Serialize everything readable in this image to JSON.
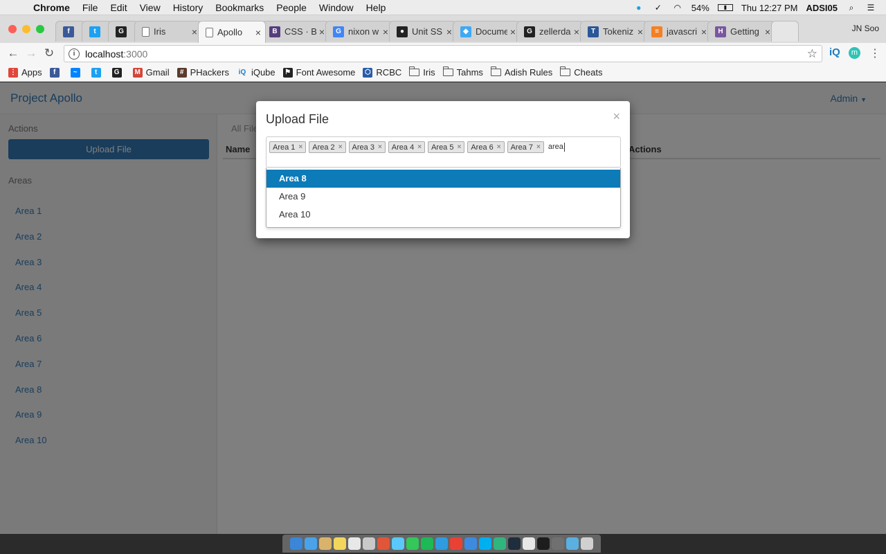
{
  "menubar": {
    "app": "Chrome",
    "items": [
      "File",
      "Edit",
      "View",
      "History",
      "Bookmarks",
      "People",
      "Window",
      "Help"
    ],
    "battery": "54%",
    "clock": "Thu 12:27 PM",
    "user": "ADSI05"
  },
  "tabs": [
    {
      "title": "",
      "icon": "facebook-icon",
      "color": "#3b5998",
      "glyph": "f"
    },
    {
      "title": "",
      "icon": "twitter-icon",
      "color": "#1da1f2",
      "glyph": "t"
    },
    {
      "title": "",
      "icon": "github-icon",
      "color": "#222222",
      "glyph": "G"
    },
    {
      "title": "Iris",
      "icon": "page-icon",
      "color": "#ffffff",
      "glyph": ""
    },
    {
      "title": "Apollo",
      "icon": "page-icon",
      "color": "#ffffff",
      "glyph": "",
      "active": true
    },
    {
      "title": "CSS · Bo",
      "icon": "bootstrap-icon",
      "color": "#563d7c",
      "glyph": "B"
    },
    {
      "title": "nixon w",
      "icon": "google-icon",
      "color": "#4285f4",
      "glyph": "G"
    },
    {
      "title": "Unit SS",
      "icon": "drop-icon",
      "color": "#222222",
      "glyph": "●"
    },
    {
      "title": "Docume",
      "icon": "diamond-icon",
      "color": "#3fa9f5",
      "glyph": "◆"
    },
    {
      "title": "zellerda",
      "icon": "github-icon",
      "color": "#222222",
      "glyph": "G"
    },
    {
      "title": "Tokeniz",
      "icon": "tokenizer-icon",
      "color": "#2b5797",
      "glyph": "T"
    },
    {
      "title": "javascri",
      "icon": "stackoverflow-icon",
      "color": "#f48024",
      "glyph": "≡"
    },
    {
      "title": "Getting",
      "icon": "heroku-icon",
      "color": "#79589f",
      "glyph": "H"
    }
  ],
  "profile": "JN Soo",
  "address": {
    "host": "localhost",
    "port": ":3000"
  },
  "bookmarks": [
    {
      "label": "Apps",
      "icon": "apps-grid-icon",
      "color": "#e0463a",
      "glyph": "⋮"
    },
    {
      "label": "",
      "icon": "facebook-icon",
      "color": "#3b5998",
      "glyph": "f"
    },
    {
      "label": "",
      "icon": "messenger-icon",
      "color": "#0084ff",
      "glyph": "~"
    },
    {
      "label": "",
      "icon": "twitter-icon",
      "color": "#1da1f2",
      "glyph": "t"
    },
    {
      "label": "",
      "icon": "github-icon",
      "color": "#222222",
      "glyph": "G"
    },
    {
      "label": "Gmail",
      "icon": "gmail-icon",
      "color": "#d44638",
      "glyph": "M"
    },
    {
      "label": "PHackers",
      "icon": "phackers-icon",
      "color": "#5a3b2e",
      "glyph": "#"
    },
    {
      "label": "iQube",
      "icon": "iqube-icon",
      "color": "#1a7bc2",
      "glyph": "iQ"
    },
    {
      "label": "Font Awesome",
      "icon": "fontawesome-icon",
      "color": "#222222",
      "glyph": "⚑"
    },
    {
      "label": "RCBC",
      "icon": "rcbc-icon",
      "color": "#2a5ba8",
      "glyph": "⬡"
    },
    {
      "label": "Iris",
      "icon": "folder-icon",
      "folder": true
    },
    {
      "label": "Tahms",
      "icon": "folder-icon",
      "folder": true
    },
    {
      "label": "Adish Rules",
      "icon": "folder-icon",
      "folder": true
    },
    {
      "label": "Cheats",
      "icon": "folder-icon",
      "folder": true
    }
  ],
  "app": {
    "brand": "Project Apollo",
    "admin_menu": "Admin",
    "actions_heading": "Actions",
    "upload_button": "Upload File",
    "areas_heading": "Areas",
    "areas": [
      "Area 1",
      "Area 2",
      "Area 3",
      "Area 4",
      "Area 5",
      "Area 6",
      "Area 7",
      "Area 8",
      "Area 9",
      "Area 10"
    ],
    "breadcrumb": "All Files",
    "table_headers": {
      "name": "Name",
      "actions": "Actions"
    }
  },
  "modal": {
    "title": "Upload File",
    "close": "×",
    "selected_tags": [
      "Area 1",
      "Area 2",
      "Area 3",
      "Area 4",
      "Area 5",
      "Area 6",
      "Area 7"
    ],
    "typed_value": "area",
    "options": [
      "Area 8",
      "Area 9",
      "Area 10"
    ],
    "highlighted_option": "Area 8"
  },
  "colors": {
    "accent": "#337ab7",
    "highlight": "#0c7bb8"
  }
}
